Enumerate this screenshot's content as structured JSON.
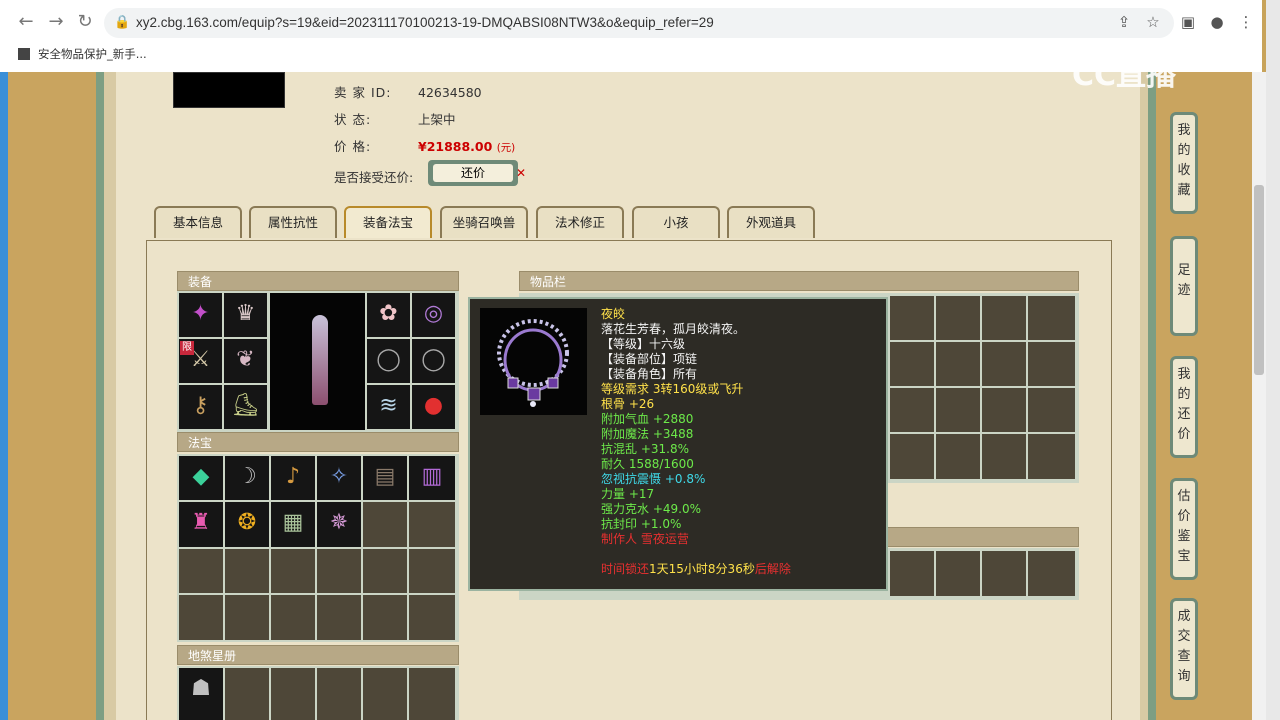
{
  "browser": {
    "url": "xy2.cbg.163.com/equip?s=19&eid=202311170100213-19-DMQABSI08NTW3&o&equip_refer=29",
    "bookmark_label": "安全物品保护_新手..."
  },
  "watermark": "CC直播",
  "seller": {
    "seller_label": "卖 家  ID:",
    "seller_id": "42634580",
    "status_label": "状      态:",
    "status_value": "上架中",
    "price_label": "价      格:",
    "price_value": "¥21888.00",
    "price_unit": "(元)",
    "offer_label": "是否接受还价:",
    "offer_button": "还价"
  },
  "tabs": [
    {
      "label": "基本信息"
    },
    {
      "label": "属性抗性"
    },
    {
      "label": "装备法宝",
      "active": true
    },
    {
      "label": "坐骑召唤兽"
    },
    {
      "label": "法术修正"
    },
    {
      "label": "小孩"
    },
    {
      "label": "外观道具"
    }
  ],
  "sections": {
    "equipment": "装备",
    "fabao": "法宝",
    "inventory": "物品栏",
    "star_book": "地煞星册"
  },
  "limit_badge": "限",
  "tooltip": {
    "name": "夜皎",
    "lines": [
      {
        "text": "落花生芳春，孤月皎清夜。",
        "color": "white"
      },
      {
        "text": "【等级】十六级",
        "color": "white"
      },
      {
        "text": "【装备部位】项链",
        "color": "white"
      },
      {
        "text": "【装备角色】所有",
        "color": "white"
      },
      {
        "text": "等级需求 3转160级或飞升",
        "color": "yellow"
      },
      {
        "text": "根骨 +26",
        "color": "yellow"
      },
      {
        "text": "附加气血 +2880",
        "color": "green"
      },
      {
        "text": "附加魔法 +3488",
        "color": "green"
      },
      {
        "text": "抗混乱 +31.8%",
        "color": "green"
      },
      {
        "text": "耐久 1588/1600",
        "color": "green"
      },
      {
        "text": "忽视抗震慑 +0.8%",
        "color": "cyan"
      },
      {
        "text": "力量 +17",
        "color": "green"
      },
      {
        "text": "强力克水 +49.0%",
        "color": "green"
      },
      {
        "text": "抗封印 +1.0%",
        "color": "green"
      },
      {
        "text": "制作人 雪夜运营",
        "color": "red"
      }
    ],
    "time_prefix": "时间锁还",
    "time_value": "1天15小时8分36秒",
    "time_suffix": "后解除"
  },
  "sidebar": [
    {
      "label": "我的收藏"
    },
    {
      "label": "足迹"
    },
    {
      "label": "我的还价"
    },
    {
      "label": "估价鉴宝"
    },
    {
      "label": "成交查询"
    }
  ]
}
